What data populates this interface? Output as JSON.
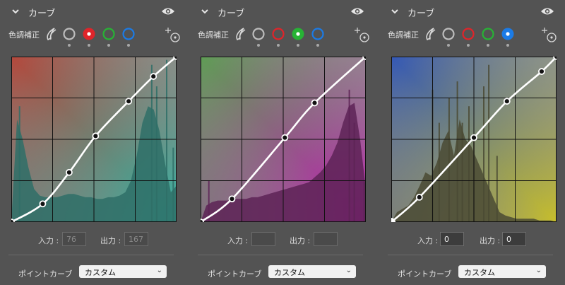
{
  "panels": [
    {
      "title": "カーブ",
      "tool_label": "色調補正",
      "selected_channel": "red",
      "input_label": "入力 :",
      "input_value": "76",
      "output_label": "出力 :",
      "output_value": "167",
      "inputs_enabled": false,
      "point_curve_label": "ポイントカーブ",
      "point_curve_value": "カスタム",
      "gradient": {
        "tl": "#b4483c",
        "tr": "#9a9a9a",
        "bl": "#7c7c7c",
        "br": "#2fb7a6"
      },
      "curve_points": [
        [
          0,
          0
        ],
        [
          0.19,
          0.11
        ],
        [
          0.35,
          0.3
        ],
        [
          0.51,
          0.52
        ],
        [
          0.71,
          0.73
        ],
        [
          0.86,
          0.88
        ],
        [
          1,
          1
        ]
      ],
      "first_point_hollow": false,
      "histogram": {
        "color": "#2f6f67",
        "levels": [
          0,
          0.62,
          0.5,
          0.33,
          0.2,
          0.16,
          0.15,
          0.15,
          0.15,
          0.16,
          0.17,
          0.17,
          0.16,
          0.15,
          0.15,
          0.14,
          0.14,
          0.15,
          0.15,
          0.16,
          0.18,
          0.25,
          0.4,
          0.6,
          0.7,
          0.68,
          0.55,
          0.35,
          0.18,
          0.22
        ],
        "spikes": [
          [
            0.05,
            0.7
          ],
          [
            0.85,
            0.95
          ],
          [
            0.88,
            0.82
          ],
          [
            0.94,
            0.98
          ],
          [
            0.98,
            0.45
          ]
        ]
      }
    },
    {
      "title": "カーブ",
      "tool_label": "色調補正",
      "selected_channel": "green",
      "input_label": "入力 :",
      "input_value": "",
      "output_label": "出力 :",
      "output_value": "",
      "inputs_enabled": false,
      "point_curve_label": "ポイントカーブ",
      "point_curve_value": "カスタム",
      "gradient": {
        "tl": "#5f9d55",
        "tr": "#9a9a9a",
        "bl": "#7c7c7c",
        "br": "#c21bb5"
      },
      "curve_points": [
        [
          0,
          0
        ],
        [
          0.19,
          0.14
        ],
        [
          0.51,
          0.51
        ],
        [
          0.69,
          0.72
        ],
        [
          1,
          1
        ]
      ],
      "first_point_hollow": false,
      "histogram": {
        "color": "#5d2356",
        "levels": [
          0,
          0.1,
          0.12,
          0.13,
          0.13,
          0.13,
          0.14,
          0.14,
          0.14,
          0.15,
          0.15,
          0.16,
          0.17,
          0.18,
          0.19,
          0.2,
          0.21,
          0.22,
          0.23,
          0.24,
          0.27,
          0.3,
          0.34,
          0.4,
          0.48,
          0.6,
          0.7,
          0.72,
          0.5,
          0.2
        ],
        "spikes": [
          [
            0.05,
            0.25
          ],
          [
            0.9,
            0.8
          ],
          [
            0.93,
            0.6
          ],
          [
            0.99,
            0.25
          ]
        ]
      }
    },
    {
      "title": "カーブ",
      "tool_label": "色調補正",
      "selected_channel": "blue",
      "input_label": "入力 :",
      "input_value": "0",
      "output_label": "出力 :",
      "output_value": "0",
      "inputs_enabled": true,
      "point_curve_label": "ポイントカーブ",
      "point_curve_value": "カスタム",
      "gradient": {
        "tl": "#3458b6",
        "tr": "#9a9a9a",
        "bl": "#7c7c7c",
        "br": "#c7be2c"
      },
      "curve_points": [
        [
          0,
          0
        ],
        [
          0.17,
          0.15
        ],
        [
          0.5,
          0.51
        ],
        [
          0.7,
          0.73
        ],
        [
          0.91,
          0.91
        ],
        [
          1,
          1
        ]
      ],
      "first_point_hollow": true,
      "histogram": {
        "color": "#4a4a34",
        "levels": [
          0,
          0.06,
          0.08,
          0.1,
          0.15,
          0.22,
          0.3,
          0.28,
          0.36,
          0.48,
          0.55,
          0.4,
          0.62,
          0.5,
          0.46,
          0.38,
          0.3,
          0.22,
          0.14,
          0.06,
          0.04,
          0.03,
          0.02,
          0.02,
          0.02,
          0.02,
          0.01,
          0.01,
          0.01,
          0.0
        ],
        "spikes": [
          [
            0.25,
            0.8
          ],
          [
            0.29,
            0.6
          ],
          [
            0.35,
            0.75
          ],
          [
            0.4,
            0.85
          ],
          [
            0.43,
            0.6
          ],
          [
            0.47,
            0.7
          ],
          [
            0.5,
            0.5
          ],
          [
            0.56,
            0.82
          ],
          [
            0.59,
            0.95
          ],
          [
            0.64,
            0.4
          ]
        ]
      }
    }
  ],
  "colors": {
    "red": "#e0242a",
    "green": "#27b335",
    "blue": "#1b7be6",
    "neutral": "#bcbcbc"
  },
  "icons": [
    "chevron-down-icon",
    "eye-icon",
    "brush-stroke-icon",
    "target-adjust-icon"
  ]
}
